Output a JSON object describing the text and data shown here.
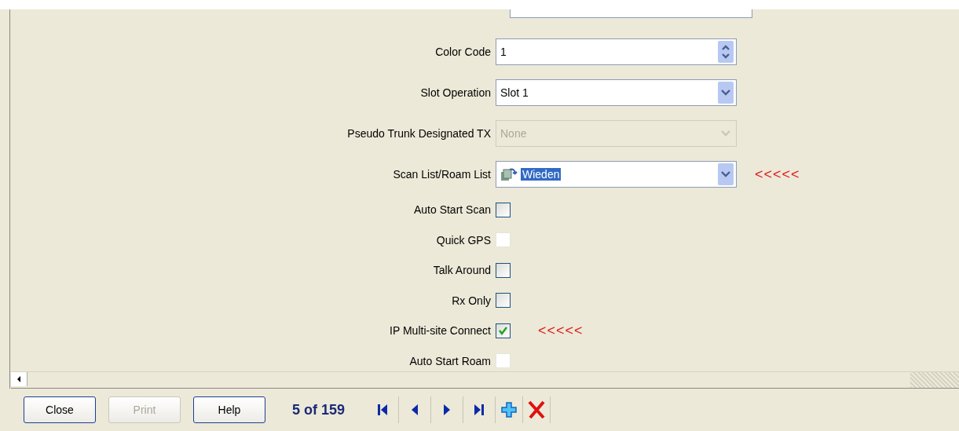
{
  "fields": [
    {
      "kind": "spinner",
      "label": "Color Code",
      "value": "1",
      "disabled": false
    },
    {
      "kind": "dropdown",
      "label": "Slot Operation",
      "value": "Slot 1",
      "disabled": false,
      "text_selected": false
    },
    {
      "kind": "dropdown",
      "label": "Pseudo Trunk Designated TX",
      "value": "None",
      "disabled": true,
      "text_selected": false
    },
    {
      "kind": "dropdown",
      "label": "Scan List/Roam List",
      "value": "Wieden",
      "disabled": false,
      "text_selected": true,
      "note": "<<<<<"
    },
    {
      "kind": "checkbox",
      "label": "Auto Start Scan",
      "checked": false,
      "disabled": false
    },
    {
      "kind": "checkbox",
      "label": "Quick GPS",
      "checked": false,
      "disabled": true
    },
    {
      "kind": "checkbox",
      "label": "Talk Around",
      "checked": false,
      "disabled": false
    },
    {
      "kind": "checkbox",
      "label": "Rx Only",
      "checked": false,
      "disabled": false
    },
    {
      "kind": "checkbox",
      "label": "IP Multi-site Connect",
      "checked": true,
      "disabled": false,
      "note": "<<<<<"
    },
    {
      "kind": "checkbox",
      "label": "Auto Start Roam",
      "checked": false,
      "disabled": true
    }
  ],
  "buttons": [
    {
      "label": "Close",
      "disabled": false
    },
    {
      "label": "Print",
      "disabled": true
    },
    {
      "label": "Help",
      "disabled": false
    }
  ],
  "record": "5 of 159"
}
